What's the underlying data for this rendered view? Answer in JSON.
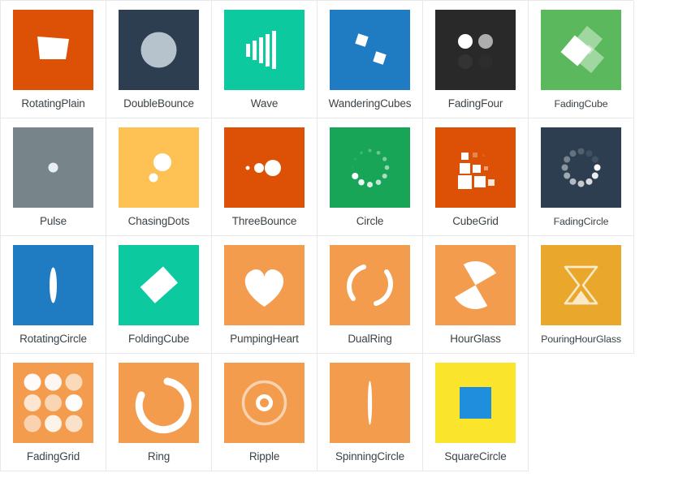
{
  "gallery": {
    "columns": 6,
    "rows": 4,
    "cell_background": "#ffffff",
    "grid_line_color": "#e6e8ea",
    "label_color": "#3b4348",
    "items": [
      {
        "label": "RotatingPlain",
        "icon": "rotating-plain-icon",
        "bg": "#DD5106",
        "fg": "#FFFFFF"
      },
      {
        "label": "DoubleBounce",
        "icon": "double-bounce-icon",
        "bg": "#2C3E50",
        "fg": "#B7C3CC"
      },
      {
        "label": "Wave",
        "icon": "wave-icon",
        "bg": "#0CC9A0",
        "fg": "#FFFFFF"
      },
      {
        "label": "WanderingCubes",
        "icon": "wandering-cubes-icon",
        "bg": "#1F7CC2",
        "fg": "#FFFFFF"
      },
      {
        "label": "FadingFour",
        "icon": "fading-four-icon",
        "bg": "#292929",
        "fg": "#FFFFFF"
      },
      {
        "label": "FadingCube",
        "icon": "fading-cube-icon",
        "bg": "#5CB85C",
        "fg": "#FFFFFF"
      },
      {
        "label": "Pulse",
        "icon": "pulse-icon",
        "bg": "#77858B",
        "fg": "#E8EEF1"
      },
      {
        "label": "ChasingDots",
        "icon": "chasing-dots-icon",
        "bg": "#FDC253",
        "fg": "#FFFFFF"
      },
      {
        "label": "ThreeBounce",
        "icon": "three-bounce-icon",
        "bg": "#DD5106",
        "fg": "#FFFFFF"
      },
      {
        "label": "Circle",
        "icon": "circle-icon",
        "bg": "#18A558",
        "fg": "#FFFFFF"
      },
      {
        "label": "CubeGrid",
        "icon": "cube-grid-icon",
        "bg": "#DD5106",
        "fg": "#FFFFFF"
      },
      {
        "label": "FadingCircle",
        "icon": "fading-circle-icon",
        "bg": "#2C3E50",
        "fg": "#FFFFFF"
      },
      {
        "label": "RotatingCircle",
        "icon": "rotating-circle-icon",
        "bg": "#1F7CC2",
        "fg": "#FFFFFF"
      },
      {
        "label": "FoldingCube",
        "icon": "folding-cube-icon",
        "bg": "#0CC9A0",
        "fg": "#FFFFFF"
      },
      {
        "label": "PumpingHeart",
        "icon": "pumping-heart-icon",
        "bg": "#F39C4E",
        "fg": "#FFFFFF"
      },
      {
        "label": "DualRing",
        "icon": "dual-ring-icon",
        "bg": "#F39C4E",
        "fg": "#FFFFFF"
      },
      {
        "label": "HourGlass",
        "icon": "hour-glass-icon",
        "bg": "#F39C4E",
        "fg": "#FFFFFF"
      },
      {
        "label": "PouringHourGlass",
        "icon": "pouring-hour-glass-icon",
        "bg": "#E9A72B",
        "fg": "#FBE9C9"
      },
      {
        "label": "FadingGrid",
        "icon": "fading-grid-icon",
        "bg": "#F39C4E",
        "fg": "#FFFFFF"
      },
      {
        "label": "Ring",
        "icon": "ring-icon",
        "bg": "#F39C4E",
        "fg": "#FFFFFF"
      },
      {
        "label": "Ripple",
        "icon": "ripple-icon",
        "bg": "#F39C4E",
        "fg": "#FFFFFF"
      },
      {
        "label": "SpinningCircle",
        "icon": "spinning-circle-icon",
        "bg": "#F39C4E",
        "fg": "#FFFFFF"
      },
      {
        "label": "SquareCircle",
        "icon": "square-circle-icon",
        "bg": "#FAE52C",
        "fg": "#1F8FDD"
      }
    ]
  }
}
